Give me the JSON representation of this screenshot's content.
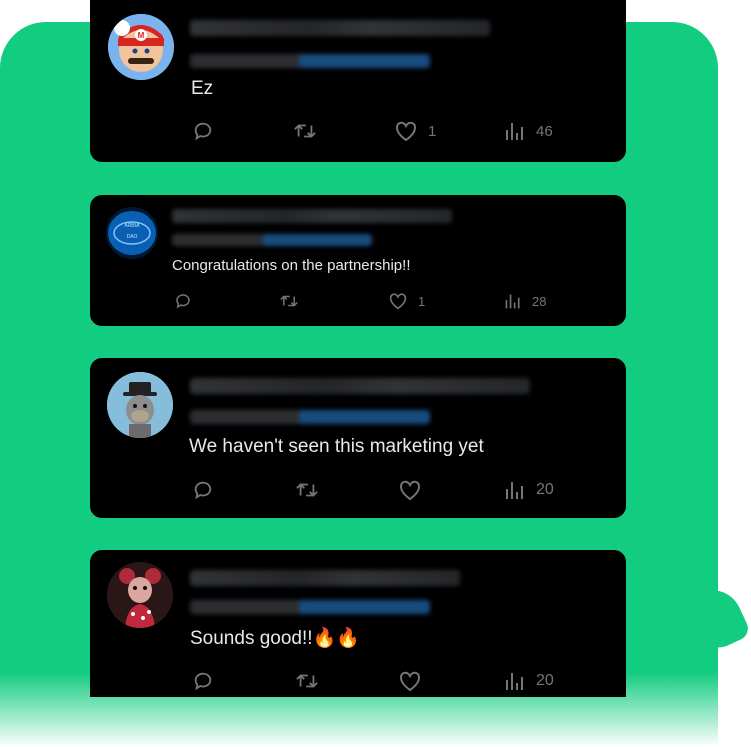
{
  "colors": {
    "brand_green": "#12cc80",
    "card_bg": "#000000",
    "text": "#e7e9ea",
    "muted": "#71767b",
    "link_blue": "#1d9bf0"
  },
  "tweets": [
    {
      "text": "Ez",
      "reply_count": "",
      "retweet_count": "",
      "like_count": "1",
      "view_count": "46",
      "avatar": "mario-avatar"
    },
    {
      "text": "Congratulations on the partnership!!",
      "reply_count": "",
      "retweet_count": "",
      "like_count": "1",
      "view_count": "28",
      "avatar": "blue-logo-avatar"
    },
    {
      "text": "We haven't seen this marketing yet",
      "reply_count": "",
      "retweet_count": "",
      "like_count": "",
      "view_count": "20",
      "avatar": "ape-nft-avatar"
    },
    {
      "text": "Sounds good!!🔥🔥",
      "reply_count": "",
      "retweet_count": "",
      "like_count": "",
      "view_count": "20",
      "avatar": "character-avatar"
    }
  ]
}
